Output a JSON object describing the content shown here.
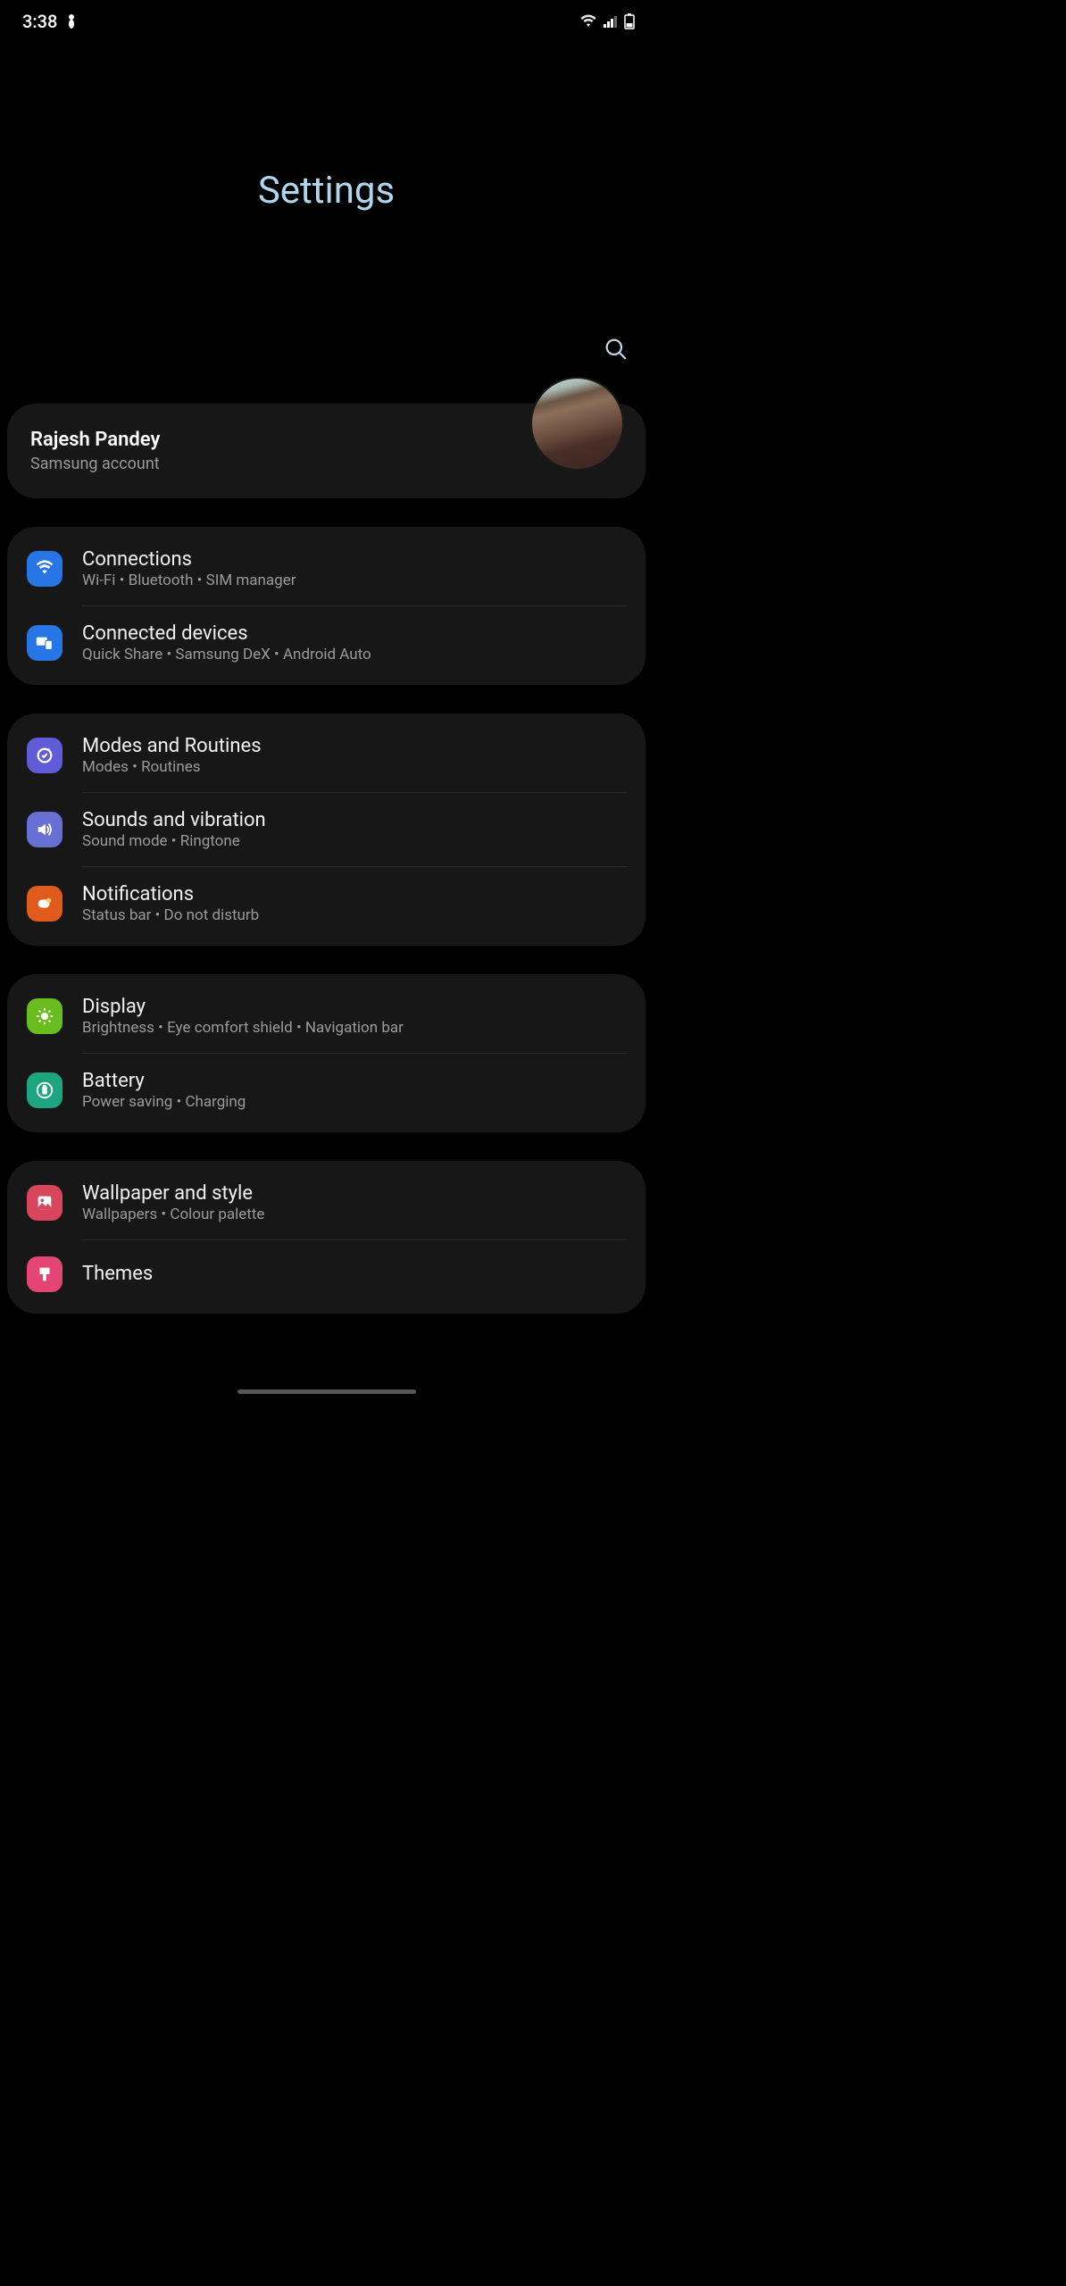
{
  "statusBar": {
    "time": "3:38"
  },
  "title": "Settings",
  "account": {
    "name": "Rajesh Pandey",
    "description": "Samsung account"
  },
  "groups": [
    {
      "items": [
        {
          "id": "connections",
          "title": "Connections",
          "subtitle": "Wi-Fi  •  Bluetooth  •  SIM manager",
          "iconBg": "bg-blue",
          "icon": "wifi"
        },
        {
          "id": "connected-devices",
          "title": "Connected devices",
          "subtitle": "Quick Share  •  Samsung DeX  •  Android Auto",
          "iconBg": "bg-blue",
          "icon": "devices"
        }
      ]
    },
    {
      "items": [
        {
          "id": "modes-routines",
          "title": "Modes and Routines",
          "subtitle": "Modes  •  Routines",
          "iconBg": "bg-purple",
          "icon": "routines"
        },
        {
          "id": "sounds-vibration",
          "title": "Sounds and vibration",
          "subtitle": "Sound mode  •  Ringtone",
          "iconBg": "bg-lightpurple",
          "icon": "sound"
        },
        {
          "id": "notifications",
          "title": "Notifications",
          "subtitle": "Status bar  •  Do not disturb",
          "iconBg": "bg-orange",
          "icon": "notification"
        }
      ]
    },
    {
      "items": [
        {
          "id": "display",
          "title": "Display",
          "subtitle": "Brightness  •  Eye comfort shield  •  Navigation bar",
          "iconBg": "bg-green",
          "icon": "brightness"
        },
        {
          "id": "battery",
          "title": "Battery",
          "subtitle": "Power saving  •  Charging",
          "iconBg": "bg-teal",
          "icon": "battery"
        }
      ]
    },
    {
      "items": [
        {
          "id": "wallpaper-style",
          "title": "Wallpaper and style",
          "subtitle": "Wallpapers  •  Colour palette",
          "iconBg": "bg-pink",
          "icon": "wallpaper"
        },
        {
          "id": "themes",
          "title": "Themes",
          "subtitle": "",
          "iconBg": "bg-pink2",
          "icon": "themes"
        }
      ]
    }
  ]
}
